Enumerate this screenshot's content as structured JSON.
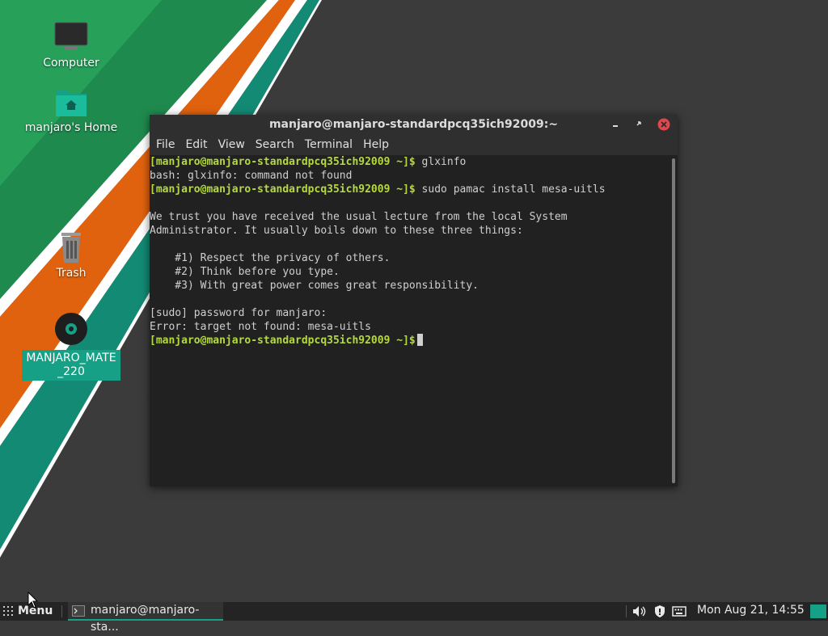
{
  "desktop": {
    "icons": [
      {
        "label": "Computer"
      },
      {
        "label": "manjaro's Home"
      },
      {
        "label": "Trash"
      },
      {
        "label": "MANJARO_MATE_220"
      }
    ]
  },
  "terminal": {
    "title": "manjaro@manjaro-standardpcq35ich92009:~",
    "menu": [
      "File",
      "Edit",
      "View",
      "Search",
      "Terminal",
      "Help"
    ],
    "prompt": "[manjaro@manjaro-standardpcq35ich92009 ~]$",
    "lines": [
      {
        "prompt": true,
        "text": " glxinfo"
      },
      {
        "prompt": false,
        "text": "bash: glxinfo: command not found"
      },
      {
        "prompt": true,
        "text": " sudo pamac install mesa-uitls"
      },
      {
        "prompt": false,
        "text": ""
      },
      {
        "prompt": false,
        "text": "We trust you have received the usual lecture from the local System"
      },
      {
        "prompt": false,
        "text": "Administrator. It usually boils down to these three things:"
      },
      {
        "prompt": false,
        "text": ""
      },
      {
        "prompt": false,
        "text": "    #1) Respect the privacy of others."
      },
      {
        "prompt": false,
        "text": "    #2) Think before you type."
      },
      {
        "prompt": false,
        "text": "    #3) With great power comes great responsibility."
      },
      {
        "prompt": false,
        "text": ""
      },
      {
        "prompt": false,
        "text": "[sudo] password for manjaro:"
      },
      {
        "prompt": false,
        "text": "Error: target not found: mesa-uitls"
      },
      {
        "prompt": true,
        "text": " ",
        "cursor": true
      }
    ]
  },
  "taskbar": {
    "menu_label": "Menu",
    "task_label": "manjaro@manjaro-sta...",
    "clock": "Mon Aug 21, 14:55"
  },
  "colors": {
    "accent": "#16a085",
    "prompt": "#b5d940",
    "close": "#e0474c"
  }
}
